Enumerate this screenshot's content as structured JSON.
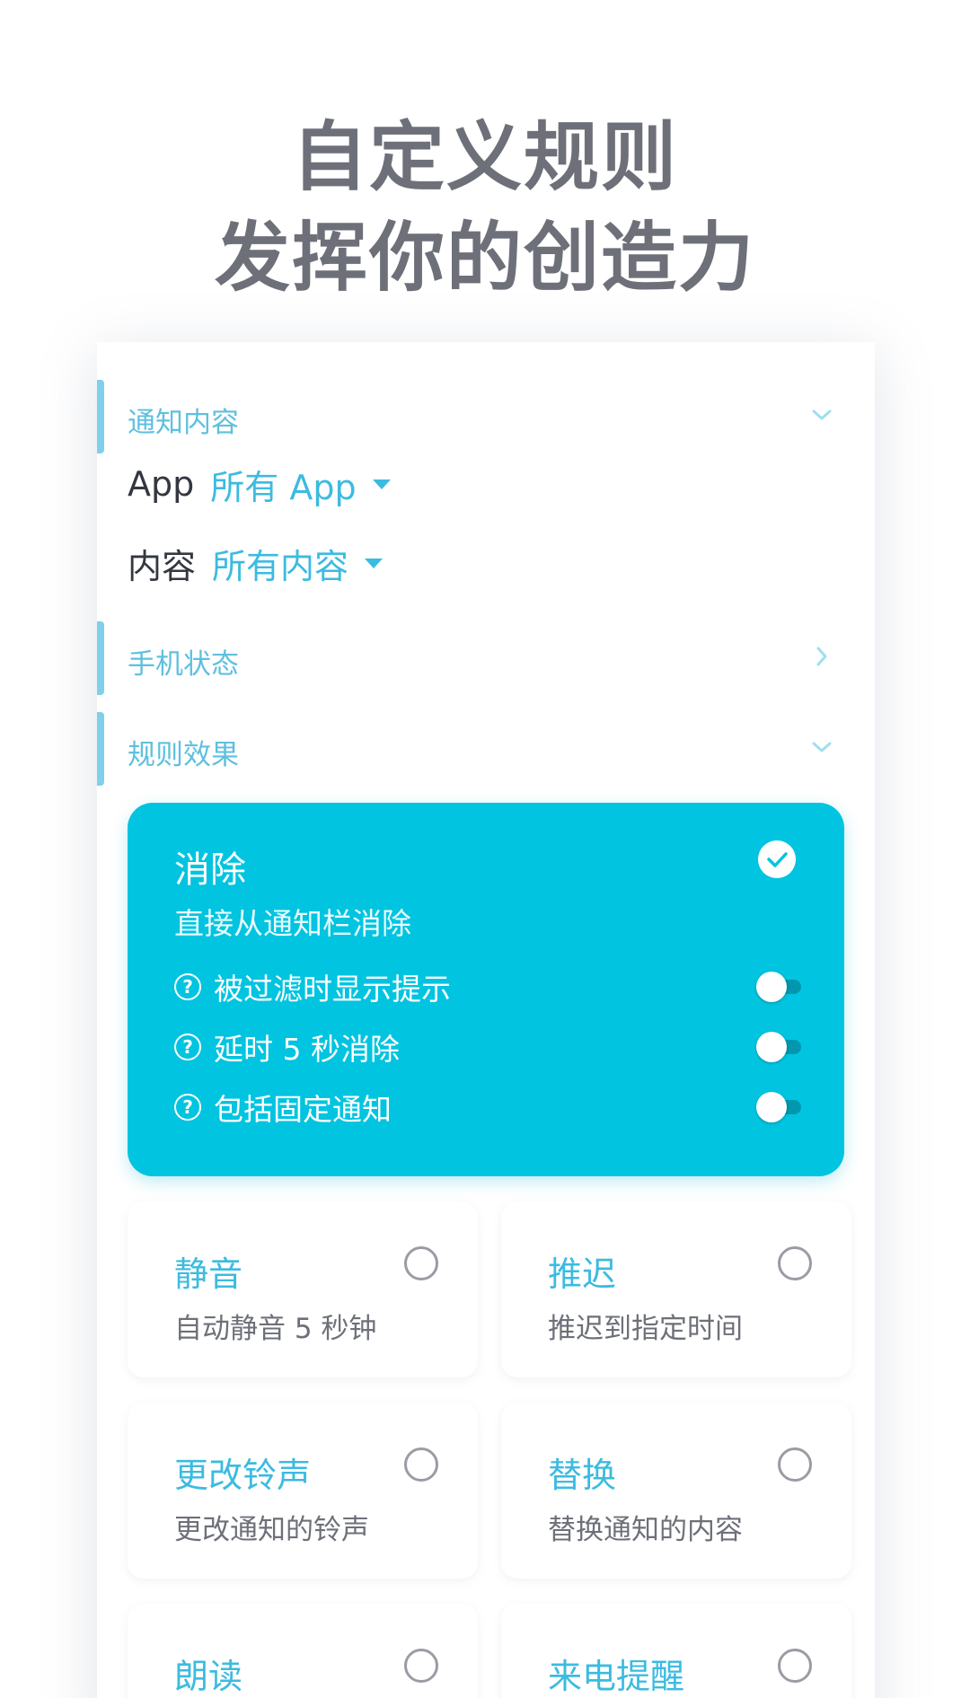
{
  "headline": {
    "line1": "自定义规则",
    "line2": "发挥你的创造力"
  },
  "sections": {
    "notification_content": {
      "title": "通知内容",
      "app_label": "App",
      "app_value": "所有 App",
      "content_label": "内容",
      "content_value": "所有内容"
    },
    "phone_state": {
      "title": "手机状态"
    },
    "rule_effect": {
      "title": "规则效果"
    }
  },
  "effect_selected": {
    "title": "消除",
    "description": "直接从通知栏消除",
    "options": [
      {
        "label": "被过滤时显示提示",
        "enabled": false
      },
      {
        "label": "延时 5 秒消除",
        "enabled": false
      },
      {
        "label": "包括固定通知",
        "enabled": false
      }
    ]
  },
  "effects": [
    {
      "title": "静音",
      "description": "自动静音 5 秒钟"
    },
    {
      "title": "推迟",
      "description": "推迟到指定时间"
    },
    {
      "title": "更改铃声",
      "description": "更改通知的铃声"
    },
    {
      "title": "替换",
      "description": "替换通知的内容"
    },
    {
      "title": "朗读",
      "description": ""
    },
    {
      "title": "来电提醒",
      "description": ""
    }
  ],
  "colors": {
    "accent": "#00c4e0",
    "link": "#3cbbe0",
    "headline": "#6e7079"
  }
}
